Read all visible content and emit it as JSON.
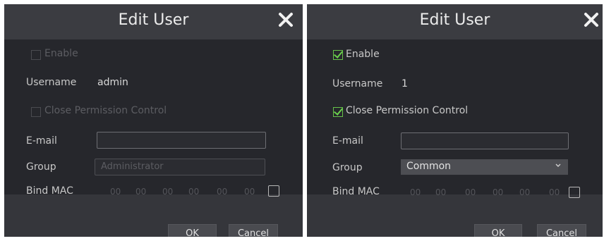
{
  "dialog_left": {
    "title": "Edit User",
    "enable_label": "Enable",
    "enable_checked": false,
    "username_label": "Username",
    "username_value": "admin",
    "close_permission_label": "Close Permission Control",
    "close_permission_checked": false,
    "email_label": "E-mail",
    "email_value": "",
    "group_label": "Group",
    "group_value": "Administrator",
    "bind_mac_label": "Bind MAC",
    "mac_octets": [
      "00",
      "00",
      "00",
      "00",
      "00",
      "00"
    ],
    "bind_mac_checked": false,
    "ok_label": "OK",
    "cancel_label": "Cancel"
  },
  "dialog_right": {
    "title": "Edit User",
    "enable_label": "Enable",
    "enable_checked": true,
    "username_label": "Username",
    "username_value": "1",
    "close_permission_label": "Close Permission Control",
    "close_permission_checked": true,
    "email_label": "E-mail",
    "email_value": "",
    "group_label": "Group",
    "group_value": "Common",
    "bind_mac_label": "Bind MAC",
    "mac_octets": [
      "00",
      "00",
      "00",
      "00",
      "00",
      "00"
    ],
    "bind_mac_checked": false,
    "ok_label": "OK",
    "cancel_label": "Cancel"
  },
  "colors": {
    "dialog_bg": "#25262b",
    "titlebar_bg": "#3b3c41",
    "check_green": "#6ad04c"
  }
}
